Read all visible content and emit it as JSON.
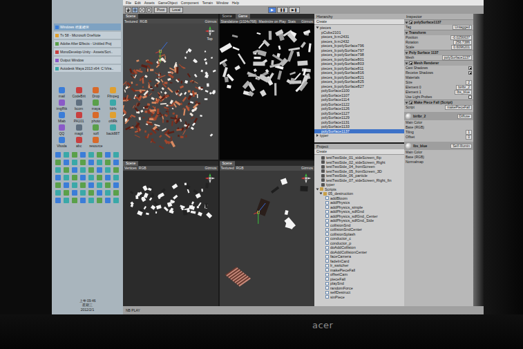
{
  "menu_bar": {
    "items": [
      "File",
      "Edit",
      "Assets",
      "GameObject",
      "Component",
      "Terrain",
      "Window",
      "Help"
    ]
  },
  "toolbar": {
    "pivot": "Pivot",
    "local": "Local",
    "play_controls": [
      {
        "label": "▶",
        "selected": true
      },
      {
        "label": "❚❚",
        "selected": false
      },
      {
        "label": "▶❚",
        "selected": false
      }
    ]
  },
  "taskbar": {
    "windows": [
      {
        "label": "Windows 檔案總管",
        "selected": true
      },
      {
        "label": "Tv 58 - Microsoft OneNote",
        "selected": false
      },
      {
        "label": "Adobe After Effects - Untitled Proj",
        "selected": false
      },
      {
        "label": "MonoDevelop-Unity - Assets/Scri..",
        "selected": false
      },
      {
        "label": "Output Window",
        "selected": false
      },
      {
        "label": "Autodesk Maya 2013 x64: C:\\Vira..",
        "selected": false
      }
    ],
    "desktop_icons": [
      "mail",
      "CodeBrit",
      "Drop",
      "Ffmpeg",
      "imgRtk",
      "bcom",
      "maya",
      "fdrfs",
      "Mlab",
      "PA101",
      "photo",
      "ofilRk",
      "QQ",
      "magit",
      "sofl",
      "back88T",
      "Vboda",
      "abc",
      "resource"
    ],
    "clock": {
      "time": "上午 09:46",
      "weekday": "星期三",
      "date": "2012/2/1"
    }
  },
  "scene_views": [
    {
      "kind": "debris-color",
      "tabs": [
        {
          "label": "Scene",
          "selected": true
        }
      ],
      "options": [
        "Textured",
        "RGB"
      ],
      "gizmos": "Gizmos",
      "orientation": "Top"
    },
    {
      "kind": "game",
      "tabs": [
        {
          "label": "Scene",
          "selected": false
        },
        {
          "label": "Game",
          "selected": true
        }
      ],
      "options": [
        "Standalone (1024x768)",
        "Maximize on Play",
        "Stats"
      ],
      "gizmos": "Gizmos"
    },
    {
      "kind": "debris-white",
      "tabs": [
        {
          "label": "Scene",
          "selected": true
        }
      ],
      "options": [
        "Vertices",
        "RGB"
      ],
      "gizmos": "Gizmos"
    },
    {
      "kind": "sparse",
      "tabs": [
        {
          "label": "Scene",
          "selected": true
        }
      ],
      "options": [
        "Textured",
        "RGB"
      ],
      "gizmos": "Gizmos"
    }
  ],
  "hierarchy": {
    "title": "Hierarchy",
    "create": "Create",
    "items": [
      {
        "label": "pieces",
        "kind": "group",
        "expanded": true,
        "selected": false
      },
      {
        "label": "pCube2101",
        "kind": "child",
        "selected": false
      },
      {
        "label": "pieces_b:m2431",
        "kind": "child",
        "selected": false
      },
      {
        "label": "pieces_b:m2432",
        "kind": "child",
        "selected": false
      },
      {
        "label": "pieces_b:polySurface796",
        "kind": "child",
        "selected": false
      },
      {
        "label": "pieces_b:polySurface797",
        "kind": "child",
        "selected": false
      },
      {
        "label": "pieces_b:polySurface798",
        "kind": "child",
        "selected": false
      },
      {
        "label": "pieces_b:polySurface801",
        "kind": "child",
        "selected": false
      },
      {
        "label": "pieces_b:polySurface803",
        "kind": "child",
        "selected": false
      },
      {
        "label": "pieces_b:polySurface811",
        "kind": "child",
        "selected": false
      },
      {
        "label": "pieces_b:polySurface816",
        "kind": "child",
        "selected": false
      },
      {
        "label": "pieces_b:polySurface821",
        "kind": "child",
        "selected": false
      },
      {
        "label": "pieces_b:polySurface825",
        "kind": "child",
        "selected": false
      },
      {
        "label": "pieces_b:polySurface827",
        "kind": "child",
        "selected": false
      },
      {
        "label": "polySurface1100",
        "kind": "child",
        "selected": false
      },
      {
        "label": "polySurface1107",
        "kind": "child",
        "selected": false
      },
      {
        "label": "polySurface1114",
        "kind": "child",
        "selected": false
      },
      {
        "label": "polySurface1122",
        "kind": "child",
        "selected": false
      },
      {
        "label": "polySurface1126",
        "kind": "child",
        "selected": false
      },
      {
        "label": "polySurface1127",
        "kind": "child",
        "selected": false
      },
      {
        "label": "polySurface1129",
        "kind": "child",
        "selected": false
      },
      {
        "label": "polySurface1131",
        "kind": "child",
        "selected": false
      },
      {
        "label": "polySurface1133",
        "kind": "child",
        "selected": false
      },
      {
        "label": "polySurface1137",
        "kind": "child",
        "selected": true
      },
      {
        "label": "typer",
        "kind": "group",
        "expanded": false,
        "selected": false
      }
    ]
  },
  "project": {
    "title": "Project",
    "create": "Create",
    "items": [
      {
        "label": "testTwoSide_01_sideScreen_flip",
        "kind": "scene"
      },
      {
        "label": "testTwoSide_02_sideScreen_Right",
        "kind": "scene"
      },
      {
        "label": "testTwoSide_04_frontScreen",
        "kind": "scene"
      },
      {
        "label": "testTwoSide_05_frontScreen_3D",
        "kind": "scene"
      },
      {
        "label": "testTwoSide_06_particle",
        "kind": "scene"
      },
      {
        "label": "testTwoSide_07_sideScreen_Right_fin",
        "kind": "scene"
      },
      {
        "label": "typer",
        "kind": "scene"
      },
      {
        "label": "Scripts",
        "kind": "folder",
        "expanded": true
      },
      {
        "label": "05_destruction",
        "kind": "subfolder",
        "expanded": true
      },
      {
        "label": "addBloom",
        "kind": "script"
      },
      {
        "label": "addPhysics",
        "kind": "script"
      },
      {
        "label": "addPhysics_simple",
        "kind": "script"
      },
      {
        "label": "addPhysics_sdfGnd",
        "kind": "script"
      },
      {
        "label": "addPhysics_sdfGnd_Center",
        "kind": "script"
      },
      {
        "label": "addPhysics_sdfGnd_Side",
        "kind": "script"
      },
      {
        "label": "collisionSnd",
        "kind": "script"
      },
      {
        "label": "collisionSndCenter",
        "kind": "script"
      },
      {
        "label": "collisionSplash",
        "kind": "script"
      },
      {
        "label": "conductor_c",
        "kind": "script"
      },
      {
        "label": "conductor_p",
        "kind": "script"
      },
      {
        "label": "doAddCollision",
        "kind": "script"
      },
      {
        "label": "doAddCollisionCenter",
        "kind": "script"
      },
      {
        "label": "faceCamera",
        "kind": "script"
      },
      {
        "label": "fadeInCard",
        "kind": "script"
      },
      {
        "label": "lr_switcher",
        "kind": "script"
      },
      {
        "label": "makePieceFall",
        "kind": "script"
      },
      {
        "label": "offsetCam",
        "kind": "script"
      },
      {
        "label": "pieceFall",
        "kind": "script"
      },
      {
        "label": "playSnd",
        "kind": "script"
      },
      {
        "label": "randomForce",
        "kind": "script"
      },
      {
        "label": "selfDestruct",
        "kind": "script"
      },
      {
        "label": "sinPiece",
        "kind": "script"
      }
    ]
  },
  "inspector": {
    "title": "Inspector",
    "rows": [
      {
        "kind": "object",
        "label": "polySurface1137",
        "checked": true
      },
      {
        "kind": "field",
        "label": "Tag",
        "value": "Untagged"
      },
      {
        "kind": "component",
        "label": "Transform"
      },
      {
        "kind": "field",
        "label": "Position",
        "value": "-0.0256637"
      },
      {
        "kind": "field",
        "label": "Rotation",
        "value": "256.7386"
      },
      {
        "kind": "field",
        "label": "Scale",
        "value": "0.6096201"
      },
      {
        "kind": "component",
        "label": "Poly Surface 1137"
      },
      {
        "kind": "field",
        "label": "Mesh",
        "value": "polySurface1137"
      },
      {
        "kind": "component",
        "label": "Mesh Renderer",
        "checked": true
      },
      {
        "kind": "check",
        "label": "Cast Shadows",
        "checked": true
      },
      {
        "kind": "check",
        "label": "Receive Shadows",
        "checked": true
      },
      {
        "kind": "label",
        "label": "Materials"
      },
      {
        "kind": "field",
        "label": "Size",
        "value": "2"
      },
      {
        "kind": "field",
        "label": "Element 0",
        "value": "birlbr_2"
      },
      {
        "kind": "field",
        "label": "Element 1",
        "value": "lbs_blue"
      },
      {
        "kind": "check",
        "label": "Use Light Probes",
        "checked": false
      },
      {
        "kind": "component",
        "label": "Make Piece Fall (Script)",
        "checked": true
      },
      {
        "kind": "field",
        "label": "Script",
        "value": "makePieceFall"
      },
      {
        "kind": "material",
        "label": "birlbr_2",
        "value": "Diffuse"
      },
      {
        "kind": "label",
        "label": "Main Color"
      },
      {
        "kind": "label",
        "label": "Base (RGB)"
      },
      {
        "kind": "field",
        "label": "Tiling",
        "value": "1"
      },
      {
        "kind": "field",
        "label": "Offset",
        "value": "0"
      },
      {
        "kind": "material",
        "label": "lbs_blue",
        "value": "Self-Illumin"
      },
      {
        "kind": "label",
        "label": "Main Color"
      },
      {
        "kind": "label",
        "label": "Base (RGB)"
      },
      {
        "kind": "label",
        "label": "Normalmap"
      }
    ]
  },
  "status_bar": {
    "text": "NB PLAY"
  },
  "monitor": {
    "brand": "acer"
  }
}
